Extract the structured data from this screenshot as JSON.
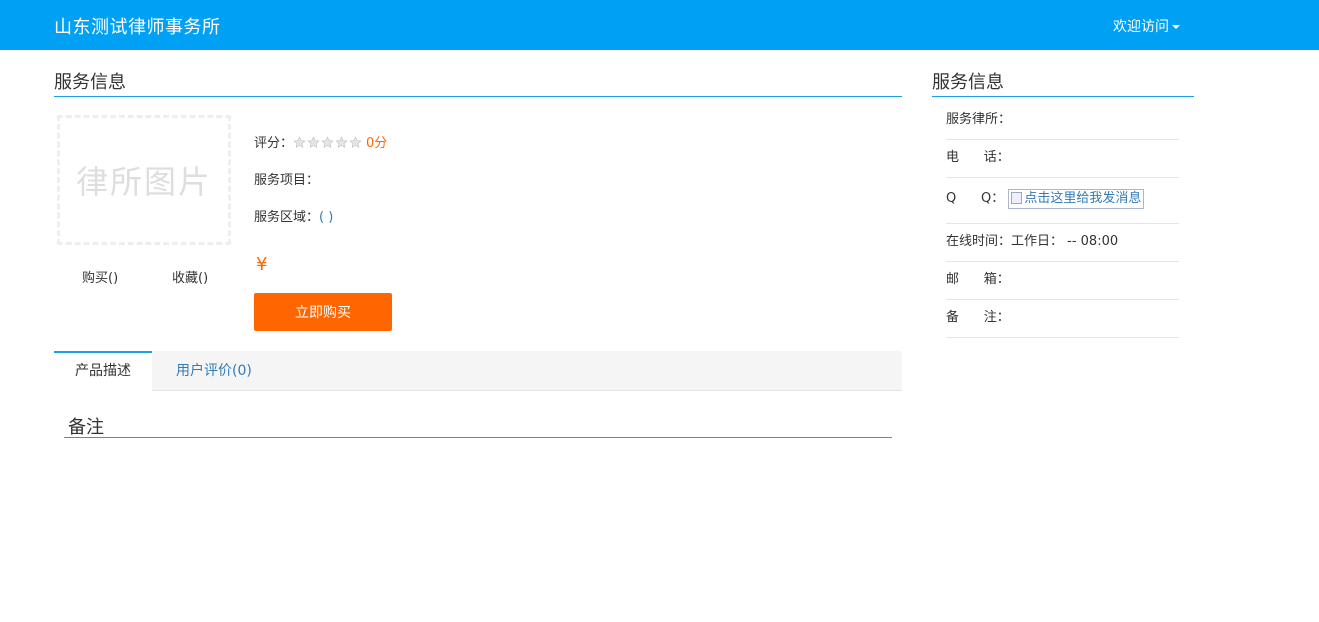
{
  "header": {
    "brand": "山东测试律师事务所",
    "welcome_menu": "欢迎访问"
  },
  "main": {
    "section_title": "服务信息",
    "photo_placeholder": "律所图片",
    "buy_link": "购买()",
    "favorite_link": "收藏()",
    "rating_label": "评分：",
    "rating_stars": 0,
    "rating_max": 5,
    "rating_score": "0分",
    "service_item_label": "服务项目：",
    "service_area_label": "服务区域：",
    "service_area_value": "( )",
    "price_symbol": "¥",
    "buy_button": "立即购买",
    "tabs": [
      {
        "label": "产品描述",
        "active": true
      },
      {
        "label": "用户评价(0)",
        "active": false
      }
    ],
    "notes_title": "备注"
  },
  "sidebar": {
    "title": "服务信息",
    "rows": [
      {
        "label": "服务律所：",
        "value": ""
      },
      {
        "label": "电      话：",
        "value": ""
      },
      {
        "label": "Q      Q：",
        "value": ""
      },
      {
        "label": "在线时间：",
        "value": "工作日： -- 08:00"
      },
      {
        "label": "邮      箱：",
        "value": ""
      },
      {
        "label": "备      注：",
        "value": ""
      }
    ],
    "qq_image_alt": "点击这里给我发消息"
  },
  "colors": {
    "header_bg": "#00a0f5",
    "accent_line": "#1e9fe8",
    "orange": "#ff6600",
    "link_blue": "#337ab7"
  },
  "icons": [
    "caret-down-icon",
    "star-icon",
    "broken-image-icon"
  ]
}
